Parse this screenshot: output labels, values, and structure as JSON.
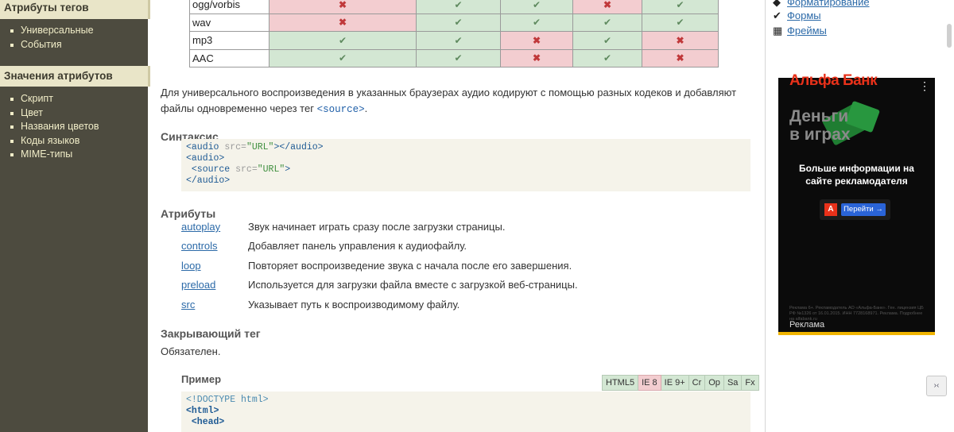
{
  "sidebar": {
    "section1_title": "Атрибуты тегов",
    "section1_items": [
      "Универсальные",
      "События"
    ],
    "section2_title": "Значения атрибутов",
    "section2_items": [
      "Скрипт",
      "Цвет",
      "Названия цветов",
      "Коды языков",
      "MIME-типы"
    ]
  },
  "compat_table": {
    "rows": [
      {
        "format": "ogg/vorbis",
        "support": [
          false,
          true,
          true,
          false,
          true
        ]
      },
      {
        "format": "wav",
        "support": [
          false,
          true,
          true,
          true,
          true
        ]
      },
      {
        "format": "mp3",
        "support": [
          true,
          true,
          false,
          true,
          false
        ]
      },
      {
        "format": "AAC",
        "support": [
          true,
          true,
          false,
          true,
          false
        ]
      }
    ],
    "yes_glyph": "✔",
    "no_glyph": "✖"
  },
  "main": {
    "intro_text": "Для универсального воспроизведения в указанных браузерах аудио кодируют с помощью разных кодеков и добавляют файлы одновременно через тег",
    "intro_tag": "<source>",
    "intro_end": ".",
    "syntax_title": "Синтаксис",
    "syntax_lines": [
      {
        "t1": "<audio",
        "a": " src=",
        "s": "\"URL\"",
        "t2": "></audio>"
      },
      {
        "t1": "<audio>",
        "a": "",
        "s": "",
        "t2": ""
      },
      {
        "t1": " <source",
        "a": " src=",
        "s": "\"URL\"",
        "t2": ">"
      },
      {
        "t1": "</audio>",
        "a": "",
        "s": "",
        "t2": ""
      }
    ],
    "attrs_title": "Атрибуты",
    "attributes": [
      {
        "name": "autoplay",
        "desc": "Звук начинает играть сразу после загрузки страницы."
      },
      {
        "name": "controls",
        "desc": "Добавляет панель управления к аудиофайлу."
      },
      {
        "name": "loop",
        "desc": "Повторяет воспроизведение звука с начала после его завершения."
      },
      {
        "name": "preload",
        "desc": "Используется для загрузки файла вместе с загрузкой веб-страницы."
      },
      {
        "name": "src",
        "desc": "Указывает путь к воспроизводимому файлу."
      }
    ],
    "closing_title": "Закрывающий тег",
    "closing_text": "Обязателен.",
    "example_title": "Пример",
    "badges": [
      {
        "label": "HTML5",
        "bad": false
      },
      {
        "label": "IE 8",
        "bad": true
      },
      {
        "label": "IE 9+",
        "bad": false
      },
      {
        "label": "Cr",
        "bad": false
      },
      {
        "label": "Op",
        "bad": false
      },
      {
        "label": "Sa",
        "bad": false
      },
      {
        "label": "Fx",
        "bad": false
      }
    ],
    "example_lines": [
      "<!DOCTYPE html>",
      "<html>",
      " <head>"
    ]
  },
  "right": {
    "links": [
      {
        "icon": "◆",
        "label": "Форматирование"
      },
      {
        "icon": "✔",
        "label": "Формы"
      },
      {
        "icon": "▦",
        "label": "Фреймы"
      }
    ],
    "ad": {
      "brand": "Альфа Банк",
      "headline_line1": "Деньги",
      "headline_line2": "в играх",
      "text": "Больше информации на сайте рекламодателя",
      "cta_logo": "А",
      "cta": "Перейти →",
      "legal": "Реклама 6+. Рекламодатель АО «Альфа-Банк». Ген. лицензия ЦБ РФ №1326 от 16.01.2015. ИНН 7728168971. Реклама. Подробнее на alfabank.ru",
      "label": "Реклама",
      "menu": "⋮"
    },
    "fab_icon": "›‹"
  }
}
